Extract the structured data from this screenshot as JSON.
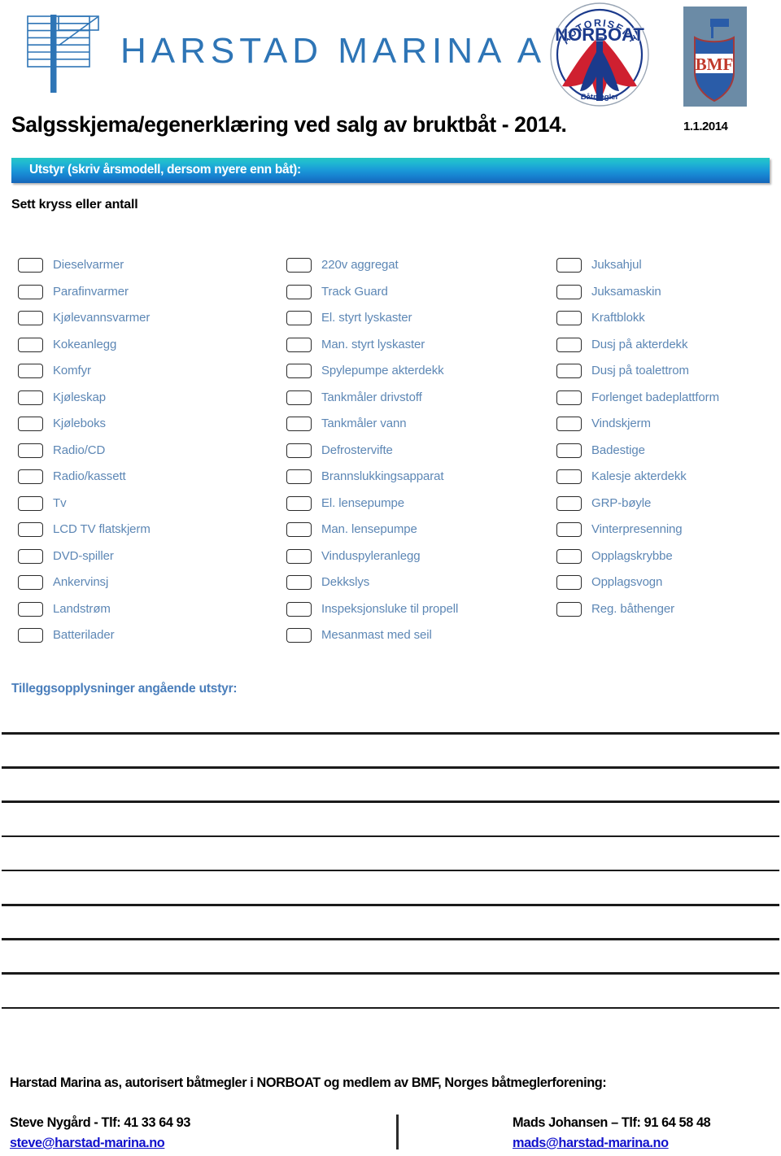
{
  "brand": {
    "company_name": "HARSTAD MARINA AS",
    "norboat_top_text": "AUTORISERT",
    "norboat_main_text": "NORBOAT",
    "norboat_bottom_text": "Båtmegler",
    "bmf_text": "BMF"
  },
  "header": {
    "title": "Salgsskjema/egenerklæring ved salg av bruktbåt - 2014.",
    "date": "1.1.2014",
    "banner_label": "Utstyr (skriv årsmodell, dersom nyere enn båt):",
    "instruction": "Sett kryss eller antall"
  },
  "equipment": {
    "column1": [
      "Dieselvarmer",
      "Parafinvarmer",
      "Kjølevannsvarmer",
      "Kokeanlegg",
      "Komfyr",
      "Kjøleskap",
      "Kjøleboks",
      "Radio/CD",
      "Radio/kassett",
      "Tv",
      "LCD TV flatskjerm",
      "DVD-spiller",
      "Ankervinsj",
      "Landstrøm",
      "Batterilader"
    ],
    "column2": [
      "220v aggregat",
      "Track Guard",
      "El. styrt lyskaster",
      "Man. styrt lyskaster",
      "Spylepumpe akterdekk",
      "Tankmåler drivstoff",
      "Tankmåler vann",
      "Defrostervifte",
      "Brannslukkingsapparat",
      "El. lensepumpe",
      "Man. lensepumpe",
      "Vinduspyleranlegg",
      "Dekkslys",
      "Inspeksjonsluke til propell",
      "Mesanmast med seil"
    ],
    "column3": [
      "Juksahjul",
      "Juksamaskin",
      "Kraftblokk",
      "Dusj på akterdekk",
      "Dusj på toalettrom",
      "Forlenget badeplattform",
      "Vindskjerm",
      "Badestige",
      "Kalesje akterdekk",
      "GRP-bøyle",
      "Vinterpresenning",
      "Opplagskrybbe",
      "Opplagsvogn",
      "Reg. båthenger"
    ]
  },
  "notes": {
    "label": "Tilleggsopplysninger angående utstyr:",
    "line_count": 9
  },
  "footer": {
    "heading": "Harstad Marina as, autorisert båtmegler i NORBOAT og medlem av BMF, Norges båtmeglerforening:",
    "contacts": [
      {
        "name": "Steve Nygård - Tlf: 41 33 64 93",
        "email": "steve@harstad-marina.no"
      },
      {
        "name": "Mads Johansen – Tlf: 91 64 58 48",
        "email": "mads@harstad-marina.no"
      }
    ]
  },
  "colors": {
    "brand_blue": "#2e75b6",
    "label_blue": "#5d87b5",
    "notes_blue": "#4a7ebb",
    "link_blue": "#1111cc",
    "banner_start": "#25c6c6",
    "banner_end": "#1565b8"
  }
}
